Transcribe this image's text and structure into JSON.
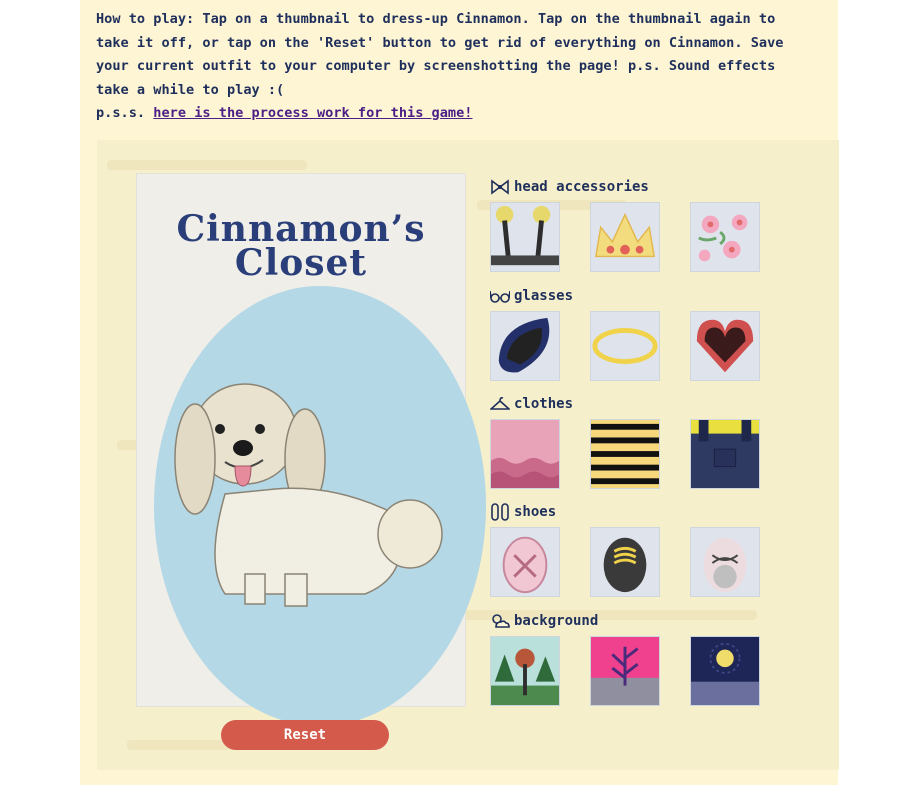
{
  "intro": {
    "text": "How to play: Tap on a thumbnail to dress-up Cinnamon. Tap on the thumbnail again to take it off, or tap on the 'Reset' button to get rid of everything on Cinnamon. Save your current outfit to your computer by screenshotting the page! p.s. Sound effects take a while to play :(",
    "pss_prefix": "p.s.s. ",
    "pss_link": "here is the process work for this game!"
  },
  "game": {
    "title_line1": "Cinnamon’s",
    "title_line2": "Closet",
    "reset_label": "Reset"
  },
  "categories": [
    {
      "label": "head accessories",
      "icon": "bow-icon",
      "items": [
        "antenna-headband",
        "crown",
        "flower-crown"
      ]
    },
    {
      "label": "glasses",
      "icon": "glasses-icon",
      "items": [
        "dark-blue-glasses",
        "yellow-oval-glasses",
        "heart-glasses"
      ]
    },
    {
      "label": "clothes",
      "icon": "hanger-icon",
      "items": [
        "pink-ruffle-top",
        "bee-stripe-top",
        "denim-overalls"
      ]
    },
    {
      "label": "shoes",
      "icon": "sandals-icon",
      "items": [
        "pink-shoe",
        "black-yellow-shoe",
        "white-bow-shoe"
      ]
    },
    {
      "label": "background",
      "icon": "weather-icon",
      "items": [
        "forest-background",
        "pink-plant-background",
        "night-moon-background"
      ]
    }
  ],
  "colors": {
    "page_bg": "#fdf5d3",
    "text_navy": "#1f2f5c",
    "link_purple": "#4b1f86",
    "reset_red": "#d45a4c",
    "oval_blue": "#b4d8e6"
  }
}
